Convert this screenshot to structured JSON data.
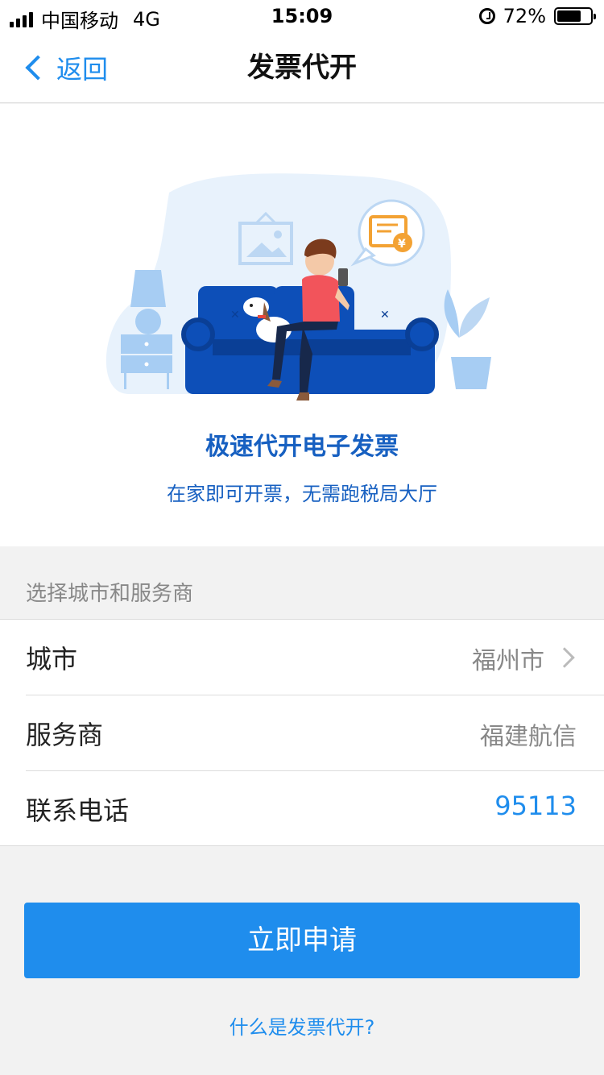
{
  "status_bar": {
    "carrier": "中国移动",
    "network": "4G",
    "time": "15:09",
    "battery": "72%",
    "battery_level": 0.72
  },
  "nav": {
    "back_label": "返回",
    "title": "发票代开"
  },
  "hero": {
    "title": "极速代开电子发票",
    "subtitle": "在家即可开票，无需跑税局大厅"
  },
  "section": {
    "header": "选择城市和服务商"
  },
  "form": {
    "city_label": "城市",
    "city_value": "福州市",
    "provider_label": "服务商",
    "provider_value": "福建航信",
    "phone_label": "联系电话",
    "phone_value": "95113"
  },
  "actions": {
    "apply_label": "立即申请",
    "help_link": "什么是发票代开?"
  },
  "colors": {
    "accent": "#1f8ded",
    "hero_text": "#1760c1",
    "sofa": "#0d4fb8"
  }
}
